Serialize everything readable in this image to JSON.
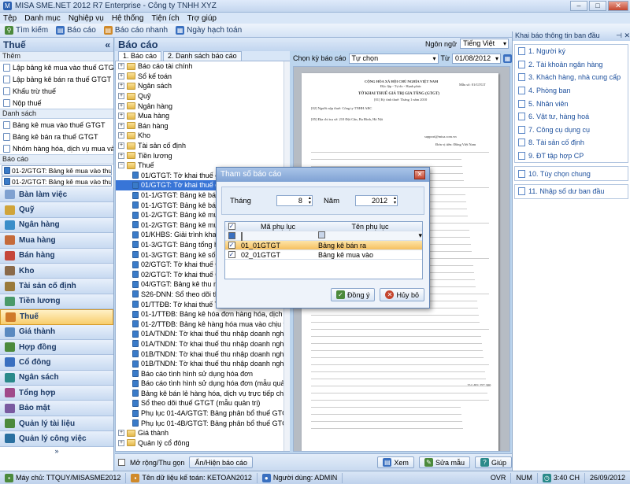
{
  "window": {
    "title": "MISA SME.NET 2012 R7 Enterprise - Công ty TNHH XYZ"
  },
  "menu": [
    "Tệp",
    "Danh mục",
    "Nghiệp vụ",
    "Hệ thống",
    "Tiện ích",
    "Trợ giúp"
  ],
  "toolbar": {
    "search": "Tìm kiếm",
    "report": "Báo cáo",
    "quick_report": "Báo cáo nhanh",
    "posting_date": "Ngày hạch toán"
  },
  "left": {
    "title": "Thuế",
    "section_add": "Thêm",
    "add_items": [
      "Lập bảng kê mua vào thuế GTGT",
      "Lập bảng kê bán ra thuế GTGT",
      "Khấu trừ thuế",
      "Nộp thuế"
    ],
    "section_list": "Danh sách",
    "list_items": [
      "Bảng kê mua vào thuế GTGT",
      "Bảng kê bán ra thuế GTGT",
      "Nhóm hàng hóa, dịch vụ mua vào"
    ],
    "section_report": "Báo cáo",
    "report_combos": [
      "01-2/GTGT: Bảng kê mua vào thuế G...",
      "01-2/GTGT: Bảng kê mua vào thuế GT"
    ],
    "modules": [
      "Bàn làm việc",
      "Quỹ",
      "Ngân hàng",
      "Mua hàng",
      "Bán hàng",
      "Kho",
      "Tài sản cố định",
      "Tiền lương",
      "Thuế",
      "Giá thành",
      "Hợp đồng",
      "Cổ đông",
      "Ngân sách",
      "Tổng hợp",
      "Bảo mật",
      "Quản lý tài liệu",
      "Quản lý công việc"
    ],
    "active_module": "Thuế"
  },
  "center": {
    "title": "Báo cáo",
    "tabs": [
      "1. Báo cáo",
      "2. Danh sách báo cáo"
    ],
    "language_label": "Ngôn ngữ",
    "language_value": "Tiếng Việt",
    "period_label": "Chọn kỳ báo cáo",
    "period_value": "Tự chọn",
    "from_label": "Từ",
    "from_value": "01/08/2012",
    "tree": [
      {
        "level": 0,
        "kind": "folder",
        "label": "Báo cáo tài chính"
      },
      {
        "level": 0,
        "kind": "folder",
        "label": "Sổ kế toán"
      },
      {
        "level": 0,
        "kind": "folder",
        "label": "Ngân sách"
      },
      {
        "level": 0,
        "kind": "folder",
        "label": "Quỹ"
      },
      {
        "level": 0,
        "kind": "folder",
        "label": "Ngân hàng"
      },
      {
        "level": 0,
        "kind": "folder",
        "label": "Mua hàng"
      },
      {
        "level": 0,
        "kind": "folder",
        "label": "Bán hàng"
      },
      {
        "level": 0,
        "kind": "folder",
        "label": "Kho"
      },
      {
        "level": 0,
        "kind": "folder",
        "label": "Tài sản cố định"
      },
      {
        "level": 0,
        "kind": "folder",
        "label": "Tiền lương"
      },
      {
        "level": 0,
        "kind": "open",
        "label": "Thuế"
      },
      {
        "level": 1,
        "kind": "rep",
        "label": "01/GTGT: Tờ khai thuế giá trị gia tăng"
      },
      {
        "level": 1,
        "kind": "rep",
        "label": "01/GTGT: Tờ khai thuế giá trị gia tăng",
        "selected": true
      },
      {
        "level": 1,
        "kind": "rep",
        "label": "01-1/GTGT: Bảng kê bán ra"
      },
      {
        "level": 1,
        "kind": "rep",
        "label": "01-1/GTGT: Bảng kê bán ra"
      },
      {
        "level": 1,
        "kind": "rep",
        "label": "01-2/GTGT: Bảng kê mua vào"
      },
      {
        "level": 1,
        "kind": "rep",
        "label": "01-2/GTGT: Bảng kê mua vào"
      },
      {
        "level": 1,
        "kind": "rep",
        "label": "01/KHBS: Giải trình khai bổ sung"
      },
      {
        "level": 1,
        "kind": "rep",
        "label": "01-3/GTGT: Bảng tổng hợp thuế"
      },
      {
        "level": 1,
        "kind": "rep",
        "label": "01-3/GTGT: Bảng kê số lượng xe"
      },
      {
        "level": 1,
        "kind": "rep",
        "label": "02/GTGT: Tờ khai thuế GTGT"
      },
      {
        "level": 1,
        "kind": "rep",
        "label": "02/GTGT: Tờ khai thuế GTGT"
      },
      {
        "level": 1,
        "kind": "rep",
        "label": "04/GTGT: Bảng kê thu mua"
      },
      {
        "level": 1,
        "kind": "rep",
        "label": "S26-DNN: Sổ theo dõi thuế GTGT"
      },
      {
        "level": 1,
        "kind": "rep",
        "label": "01/TTĐB: Tờ khai thuế TTĐB"
      },
      {
        "level": 1,
        "kind": "rep",
        "label": "01-1/TTĐB: Bảng kê hóa đơn hàng hóa, dịch vụ bán ra"
      },
      {
        "level": 1,
        "kind": "rep",
        "label": "01-2/TTĐB: Bảng kê hàng hóa mua vào chịu thuế TTĐ"
      },
      {
        "level": 1,
        "kind": "rep",
        "label": "01A/TNDN: Tờ khai thuế thu nhập doanh nghiệp tạm tí"
      },
      {
        "level": 1,
        "kind": "rep",
        "label": "01A/TNDN: Tờ khai thuế thu nhập doanh nghiệp tạm tí"
      },
      {
        "level": 1,
        "kind": "rep",
        "label": "01B/TNDN: Tờ khai thuế thu nhập doanh nghiệp tạm tí"
      },
      {
        "level": 1,
        "kind": "rep",
        "label": "01B/TNDN: Tờ khai thuế thu nhập doanh nghiệp tạm tí"
      },
      {
        "level": 1,
        "kind": "rep",
        "label": "Báo cáo tình hình sử dụng hóa đơn"
      },
      {
        "level": 1,
        "kind": "rep",
        "label": "Báo cáo tình hình sử dụng hóa đơn (mẫu quản trị)"
      },
      {
        "level": 1,
        "kind": "rep",
        "label": "Bảng kê bán lẻ hàng hóa, dịch vụ trực tiếp cho người tiê"
      },
      {
        "level": 1,
        "kind": "rep",
        "label": "Sổ theo dõi thuế GTGT (mẫu quản trị)"
      },
      {
        "level": 1,
        "kind": "rep",
        "label": "Phụ lục 01-4A/GTGT: Bảng phân bổ thuế GTGT đầu v"
      },
      {
        "level": 1,
        "kind": "rep",
        "label": "Phụ lục 01-4B/GTGT: Bảng phân bổ thuế GTGT đầu v"
      },
      {
        "level": 0,
        "kind": "folder",
        "label": "Giá thành"
      },
      {
        "level": 0,
        "kind": "folder",
        "label": "Quản lý cổ đông"
      }
    ],
    "expand_label": "Mở rộng/Thu gọn",
    "toggle_label": "Ẩn/Hiện báo cáo",
    "view_btn": "Xem",
    "edit_btn": "Sửa mẫu",
    "help_btn": "Giúp"
  },
  "preview": {
    "company": "CỘNG HÒA XÃ HỘI CHỦ NGHĨA VIỆT NAM",
    "motto": "Độc lập - Tự do - Hạnh phúc",
    "doc_title": "TỜ KHAI THUẾ GIÁ TRỊ GIA TĂNG (GTGT)",
    "period": "[01] Kỳ tính thuế: Tháng 1 năm 2010",
    "form_no": "Mẫu số: 01/GTGT",
    "taxpayer": "[02] Người nộp thuế: Công ty TNHH ABC",
    "address": "[05] Địa chỉ trụ sở: 210 Đội Cấn, Ba Đình, Hà Nội",
    "email": "support@misa.com.vn",
    "currency": "Đơn vị tiền: Đồng Việt Nam",
    "value": "154.483.257.300"
  },
  "right": {
    "title": "Khai báo thông tin ban đầu",
    "group1": [
      "1. Người ký",
      "2. Tài khoản ngân hàng",
      "3. Khách hàng, nhà cung cấp",
      "4. Phòng ban",
      "5. Nhân viên",
      "6. Vật tư, hàng hoá",
      "7. Công cụ dụng cụ",
      "8. Tài sản cố định",
      "9. ĐT tập hợp CP"
    ],
    "group2": [
      "10. Tùy chọn chung"
    ],
    "group3": [
      "11. Nhập số dư ban đầu"
    ]
  },
  "dialog": {
    "title": "Tham số báo cáo",
    "month_label": "Tháng",
    "month_value": "8",
    "year_label": "Năm",
    "year_value": "2012",
    "col_code": "Mã phụ lục",
    "col_name": "Tên phụ lục",
    "rows": [
      {
        "code": "01_01GTGT",
        "name": "Bảng kê bán ra",
        "checked": true
      },
      {
        "code": "02_01GTGT",
        "name": "Bảng kê mua vào",
        "checked": true
      }
    ],
    "ok": "Đồng ý",
    "cancel": "Hủy bỏ"
  },
  "status": {
    "server": "Máy chủ: TTQUY/MISASME2012",
    "db": "Tên dữ liệu kế toán: KETOAN2012",
    "user": "Người dùng: ADMIN",
    "ovr": "OVR",
    "num": "NUM",
    "time": "3:40 CH",
    "date": "26/09/2012"
  },
  "colors": {
    "accent": "#3875d7",
    "active_module": "#f8cd6c",
    "panel_header": "#c1d5ef"
  }
}
